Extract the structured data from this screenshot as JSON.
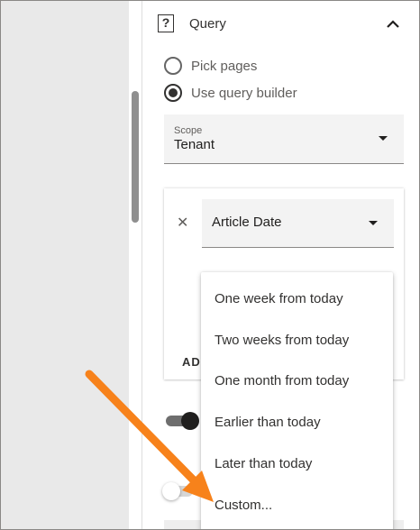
{
  "query": {
    "title": "Query",
    "radios": [
      {
        "label": "Pick pages",
        "checked": false
      },
      {
        "label": "Use query builder",
        "checked": true
      }
    ],
    "scope": {
      "label": "Scope",
      "value": "Tenant"
    },
    "filter": {
      "field_value": "Article Date",
      "add_label": "ADI"
    }
  },
  "dropdown": {
    "items": [
      "One week from today",
      "Two weeks from today",
      "One month from today",
      "Earlier than today",
      "Later than today",
      "Custom..."
    ]
  },
  "toggles": [
    {
      "on": true
    },
    {
      "on": false
    }
  ],
  "colors": {
    "arrow": "#f7821b",
    "toggle_on_track": "#6e6e6e",
    "toggle_on_knob": "#201f1e",
    "toggle_off_track": "#d6d6d6",
    "toggle_off_knob": "#ffffff"
  },
  "icons": {
    "query": "question-box-icon",
    "collapse": "chevron-up-icon",
    "remove": "close-icon",
    "dropdown": "caret-down-icon",
    "annotation": "orange-arrow"
  }
}
